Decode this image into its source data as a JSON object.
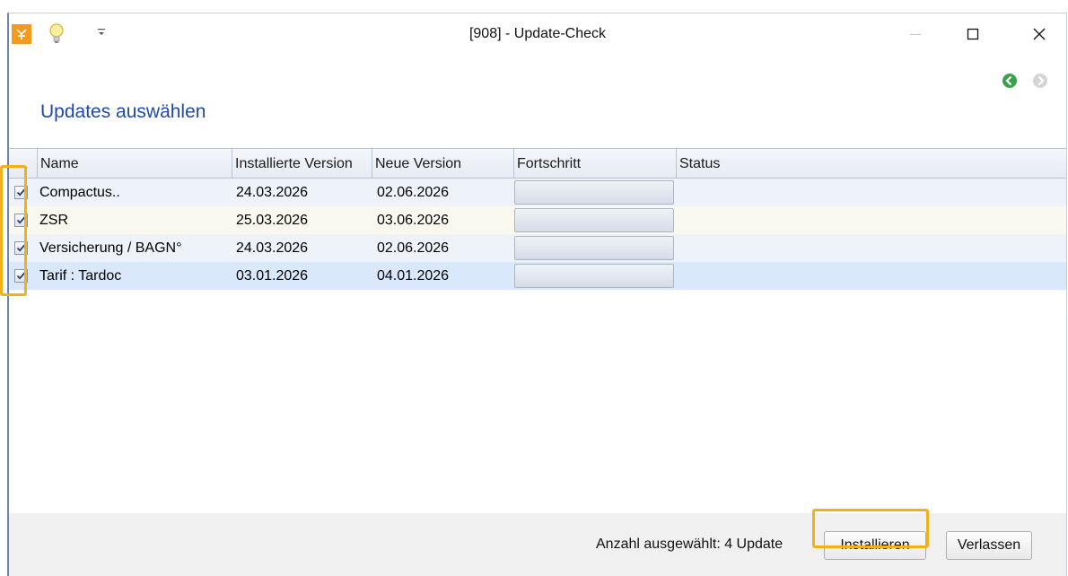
{
  "window": {
    "title": "[908] - Update-Check",
    "icons": [
      "app-icon",
      "lightbulb-icon",
      "quick-access-menu-icon",
      "minimize-icon",
      "maximize-icon",
      "close-icon",
      "back-icon",
      "forward-icon"
    ]
  },
  "page": {
    "heading": "Updates auswählen"
  },
  "table": {
    "columns": [
      "Name",
      "Installierte Version",
      "Neue Version",
      "Fortschritt",
      "Status"
    ],
    "rows": [
      {
        "checked": true,
        "name": "Compactus..",
        "installed": "24.03.2026",
        "new": "02.06.2026",
        "progress": 0,
        "status": ""
      },
      {
        "checked": true,
        "name": "ZSR",
        "installed": "25.03.2026",
        "new": "03.06.2026",
        "progress": 0,
        "status": ""
      },
      {
        "checked": true,
        "name": "Versicherung / BAGN°",
        "installed": "24.03.2026",
        "new": "02.06.2026",
        "progress": 0,
        "status": ""
      },
      {
        "checked": true,
        "name": "Tarif : Tardoc",
        "installed": "03.01.2026",
        "new": "04.01.2026",
        "progress": 0,
        "status": ""
      }
    ],
    "row_colors": [
      "#eef3fa",
      "#faf9ef",
      "#eef3fa",
      "#d9e8fb"
    ]
  },
  "footer": {
    "count_label": "Anzahl ausgewählt: 4 Update",
    "install_label": "Installieren",
    "exit_label": "Verlassen"
  },
  "colors": {
    "heading": "#1f4aa8",
    "highlight": "#f0b21a",
    "accent_orange": "#f39a1f"
  }
}
